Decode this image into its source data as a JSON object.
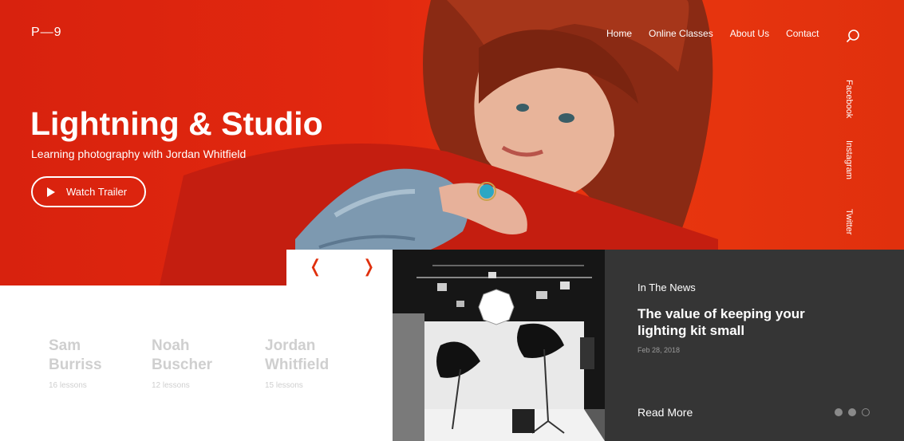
{
  "logo": "P—9",
  "nav": {
    "items": [
      "Home",
      "Online Classes",
      "About Us",
      "Contact"
    ]
  },
  "icons": {
    "search": "search-icon",
    "play": "play-icon",
    "prev": "chevron-left-icon",
    "next": "chevron-right-icon"
  },
  "social": [
    "Facebook",
    "Instagram",
    "Twitter"
  ],
  "hero": {
    "title": "Lightning & Studio",
    "subtitle": "Learning photography with Jordan Whitfield",
    "button": "Watch Trailer"
  },
  "slider": {
    "prev": "❬",
    "next": "❭"
  },
  "instructors": [
    {
      "first": "Sam",
      "last": "Burriss",
      "lessons": "16 lessons"
    },
    {
      "first": "Noah",
      "last": "Buscher",
      "lessons": "12 lessons"
    },
    {
      "first": "Jordan",
      "last": "Whitfield",
      "lessons": "15 lessons"
    }
  ],
  "news": {
    "eyebrow": "In The News",
    "title": "The value of keeping your lighting kit small",
    "date": "Feb 28, 2018",
    "read_more": "Read More"
  },
  "colors": {
    "accent": "#e0300d",
    "dark_panel": "#353535",
    "muted_text": "#cfcfcf"
  }
}
